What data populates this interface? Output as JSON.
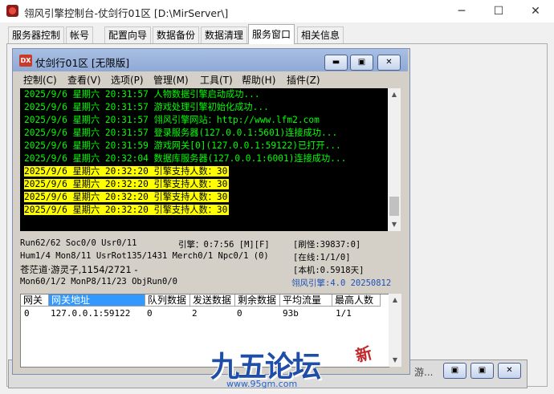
{
  "window": {
    "title": "翎风引擎控制台-仗剑行01区 [D:\\MirServer\\]",
    "minimize": "─",
    "maximize": "☐",
    "close": "✕"
  },
  "tabs": [
    "服务器控制",
    "帐号",
    "配置向导",
    "数据备份",
    "数据清理",
    "服务窗口",
    "相关信息"
  ],
  "inner_window": {
    "icon_text": "DX",
    "title": "仗剑行01区 [无限版]",
    "buttons": [
      "▬",
      "▣",
      "✕"
    ],
    "menu": [
      "控制(C)",
      "查看(V)",
      "选项(P)",
      "管理(M)",
      "工具(T)",
      "帮助(H)",
      "插件(Z)"
    ]
  },
  "log": [
    {
      "text": "2025/9/6 星期六 20:31:57 人物数据引擎启动成功...",
      "hl": false
    },
    {
      "text": "2025/9/6 星期六 20:31:57 游戏处理引擎初始化成功...",
      "hl": false
    },
    {
      "text": "2025/9/6 星期六 20:31:57 翎风引擎网站：http://www.lfm2.com",
      "hl": false
    },
    {
      "text": "2025/9/6 星期六 20:31:57 登录服务器(127.0.0.1:5601)连接成功...",
      "hl": false
    },
    {
      "text": "2025/9/6 星期六 20:31:59 游戏网关[0](127.0.0.1:59122)已打开...",
      "hl": false
    },
    {
      "text": "2025/9/6 星期六 20:32:04 数据库服务器(127.0.0.1:6001)连接成功...",
      "hl": false
    },
    {
      "text": "2025/9/6 星期六 20:32:20 引擎支持人数：30",
      "hl": true
    },
    {
      "text": "2025/9/6 星期六 20:32:20 引擎支持人数：30",
      "hl": true
    },
    {
      "text": "2025/9/6 星期六 20:32:20 引擎支持人数：30",
      "hl": true
    },
    {
      "text": "2025/9/6 星期六 20:32:20 引擎支持人数：30",
      "hl": true
    }
  ],
  "status": {
    "line1_left": "Run62/62 Soc0/0 Usr0/11",
    "line1_mid": "引擎：0:7:56 [M][F]",
    "line1_right": "[刷怪:39837:0]",
    "line2_left": "Hum1/4 Mon8/11 UsrRot135/1431 Merch0/1 Npc0/1 (0)",
    "line2_right": "[在线:1/1/0]",
    "line3_left": "苍茫道·游灵子,1154/2721 -",
    "line3_right": "[本机:0.5918天]",
    "line4_left": "Mon60/1/2 MonP8/11/23 ObjRun0/0",
    "line4_right": "翎风引擎:4.0 20250812"
  },
  "grid": {
    "headers": [
      "网关",
      "网关地址",
      "队列数据",
      "发送数据",
      "剩余数据",
      "平均流量",
      "最高人数"
    ],
    "rows": [
      [
        "0",
        "127.0.0.1:59122",
        "0",
        "2",
        "0",
        "93b",
        "1/1"
      ]
    ]
  },
  "background_window": {
    "label": "游..."
  },
  "watermark": {
    "title": "九五论坛",
    "url": "www.95gm.com",
    "seal": "新"
  }
}
